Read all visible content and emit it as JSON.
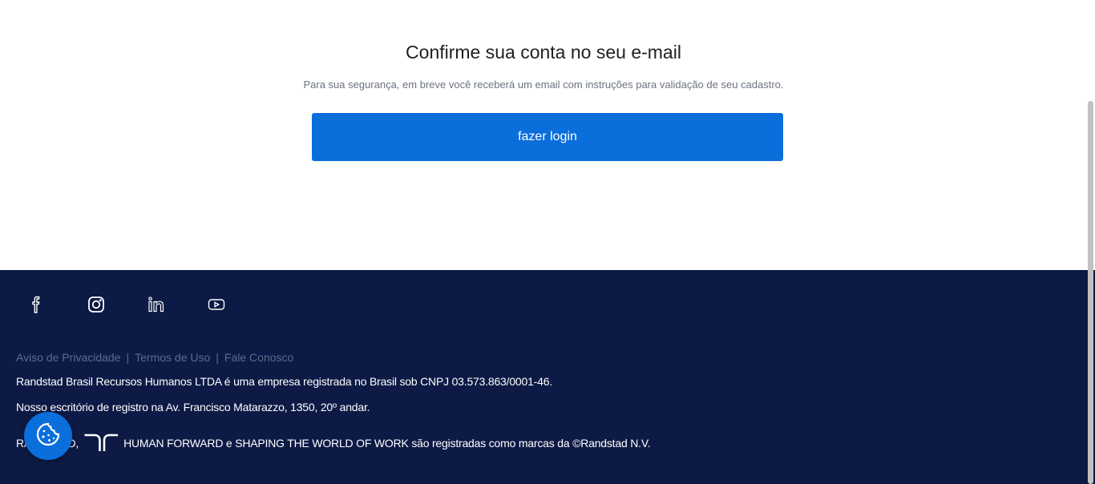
{
  "main": {
    "title": "Confirme sua conta no seu e-mail",
    "subtitle": "Para sua segurança, em breve você receberá um email com instruções para validação de seu cadastro.",
    "login_button": "fazer login"
  },
  "footer": {
    "social": [
      {
        "icon": "facebook-icon"
      },
      {
        "icon": "instagram-icon"
      },
      {
        "icon": "linkedin-icon"
      },
      {
        "icon": "youtube-icon"
      }
    ],
    "links": [
      "Aviso de Privacidade",
      "Termos de Uso",
      "Fale Conosco"
    ],
    "separator": "|",
    "company_line": "Randstad Brasil Recursos Humanos LTDA é uma empresa registrada no Brasil sob CNPJ 03.573.863/0001-46.",
    "address_line": "Nosso escritório de registro na Av. Francisco Matarazzo, 1350, 20º andar.",
    "trademark_prefix": "RANDSTAD,",
    "trademark_text": "HUMAN FORWARD e SHAPING THE WORLD OF WORK são registradas como marcas da ©Randstad N.V."
  },
  "cookie_button": {
    "icon": "cookie-icon"
  },
  "colors": {
    "primary": "#0a6edb",
    "footer_bg": "#0c1a45",
    "link_muted": "#5f6a8a"
  }
}
